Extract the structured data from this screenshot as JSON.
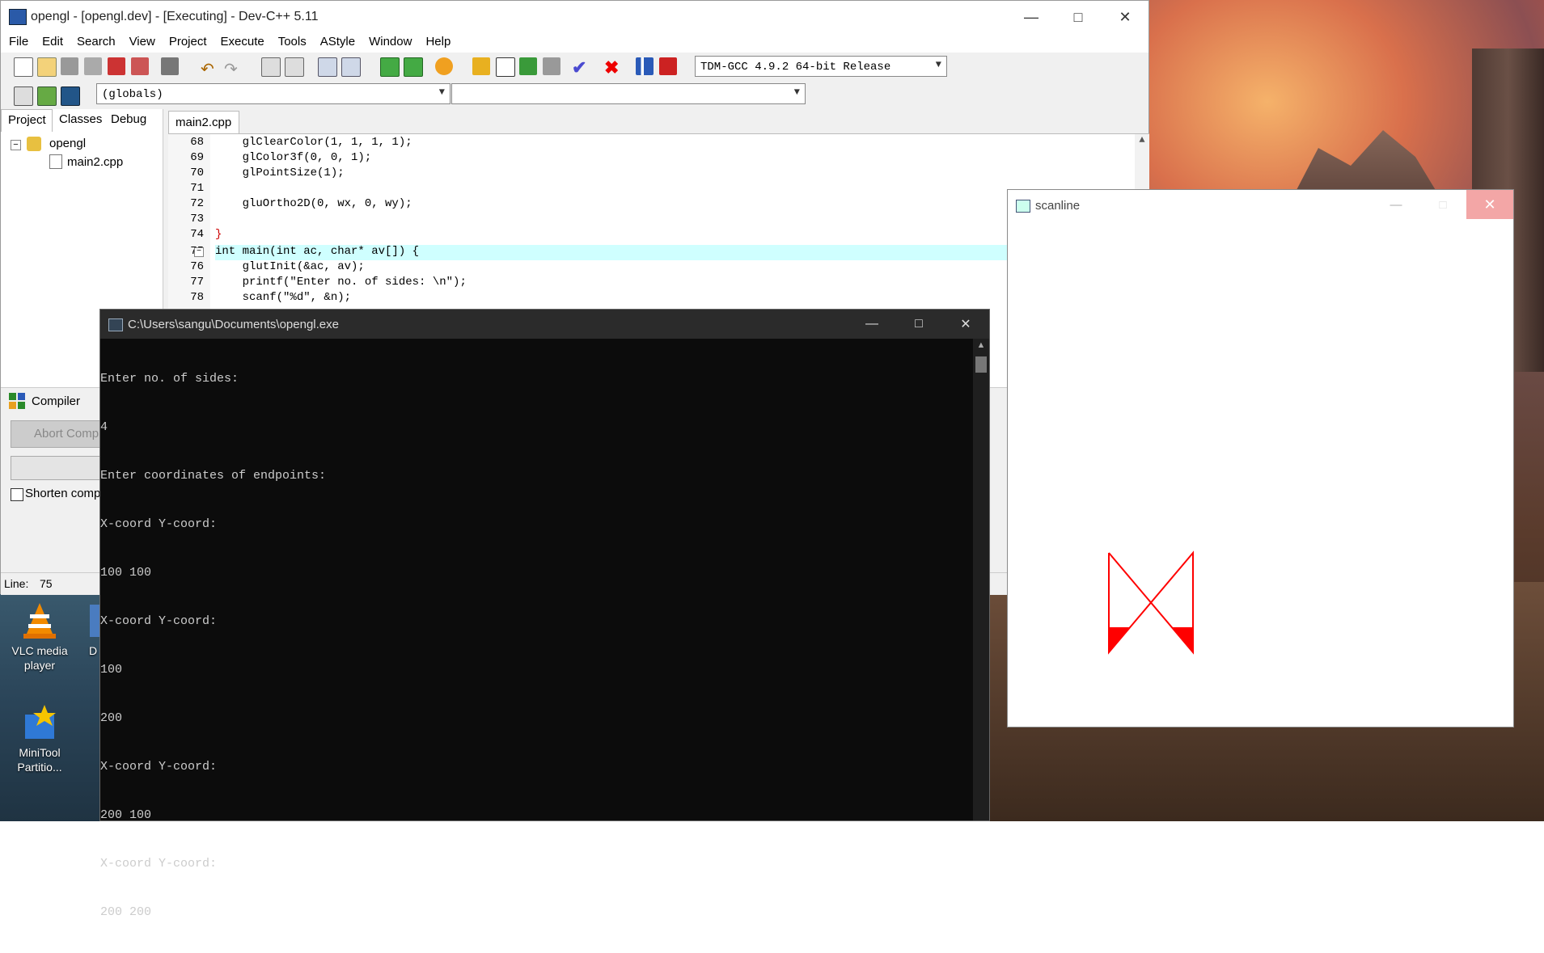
{
  "desktop": {
    "icons": [
      {
        "label": "VLC media player",
        "icon": "vlc-icon"
      },
      {
        "label": "MiniTool Partitio...",
        "icon": "minitool-icon"
      },
      {
        "label": "D",
        "icon": "partial-desktop-icon"
      }
    ]
  },
  "devcpp": {
    "title": "opengl - [opengl.dev] - [Executing] - Dev-C++ 5.11",
    "menu": [
      "File",
      "Edit",
      "Search",
      "View",
      "Project",
      "Execute",
      "Tools",
      "AStyle",
      "Window",
      "Help"
    ],
    "compiler_select": "TDM-GCC 4.9.2 64-bit Release",
    "scope_select": "(globals)",
    "function_select": "",
    "left_tabs": [
      "Project",
      "Classes",
      "Debug"
    ],
    "tree": {
      "project": "opengl",
      "file": "main2.cpp"
    },
    "file_tab": "main2.cpp",
    "code_lines": [
      {
        "n": "68",
        "text": "    glClearColor(1, 1, 1, 1);"
      },
      {
        "n": "69",
        "text": "    glColor3f(0, 0, 1);"
      },
      {
        "n": "70",
        "text": "    glPointSize(1);"
      },
      {
        "n": "71",
        "text": ""
      },
      {
        "n": "72",
        "text": "    gluOrtho2D(0, wx, 0, wy);"
      },
      {
        "n": "73",
        "text": ""
      },
      {
        "n": "74",
        "text": "}"
      },
      {
        "n": "75",
        "text": "int main(int ac, char* av[]) {"
      },
      {
        "n": "76",
        "text": "    glutInit(&ac, av);"
      },
      {
        "n": "77",
        "text": "    printf(\"Enter no. of sides: \\n\");"
      },
      {
        "n": "78",
        "text": "    scanf(\"%d\", &n);"
      }
    ],
    "bottom_tab": "Compiler",
    "abort_button": "Abort Comp",
    "shorten_label": "Shorten comp",
    "status_line_label": "Line:",
    "status_line_value": "75"
  },
  "scanline": {
    "title": "scanline",
    "shape_color": "#ff0000"
  },
  "console": {
    "title": "C:\\Users\\sangu\\Documents\\opengl.exe",
    "lines": [
      "Enter no. of sides:",
      "4",
      "Enter coordinates of endpoints:",
      "X-coord Y-coord:",
      "100 100",
      "X-coord Y-coord:",
      "100",
      "200",
      "X-coord Y-coord:",
      "200 100",
      "X-coord Y-coord:",
      "200 200"
    ]
  }
}
